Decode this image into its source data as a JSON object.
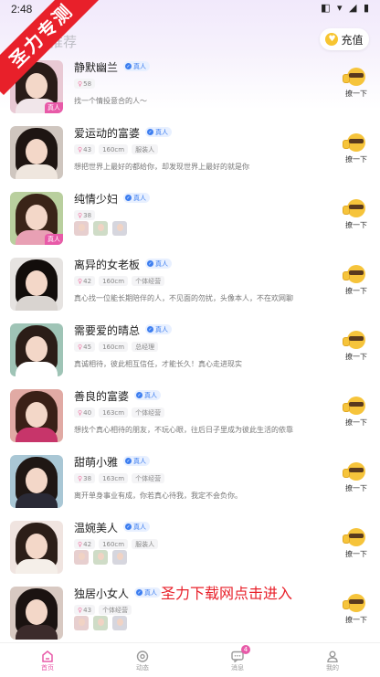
{
  "status": {
    "time": "2:48",
    "icons": "◧ ▾ ◢ ▮"
  },
  "watermark": {
    "banner": "圣力专测",
    "bottom_text": "圣力下载网点击进入"
  },
  "header": {
    "section_title": "推荐",
    "recharge_label": "充值",
    "coin_glyph": "♥"
  },
  "verify_label": "真人",
  "real_tag": "真人",
  "wave_label": "撩一下",
  "users": [
    {
      "name": "静默幽兰",
      "tags": [
        "58"
      ],
      "bio": "找一个情投意合的人～",
      "hair": "#2a1c18",
      "bg": "#e9c9d4",
      "shirt": "#f1e6ea",
      "real": true
    },
    {
      "name": "爱运动的富婆",
      "tags": [
        "43",
        "160cm",
        "服装人"
      ],
      "bio": "想把世界上最好的都给你，却发现世界上最好的就是你",
      "hair": "#1e1512",
      "bg": "#cfc6bf",
      "shirt": "#efe6de",
      "real": false
    },
    {
      "name": "纯情少妇",
      "tags": [
        "38"
      ],
      "photos": 3,
      "hair": "#3a2418",
      "bg": "#b9cf9e",
      "shirt": "#e8a0b4",
      "real": true
    },
    {
      "name": "离异的女老板",
      "tags": [
        "42",
        "160cm",
        "个体经营"
      ],
      "bio": "真心找一位能长期陪伴的人，不见面的勿扰，头像本人，不在欢网聊",
      "hair": "#120d0b",
      "bg": "#e6e3e1",
      "shirt": "#d9d4d0",
      "real": false
    },
    {
      "name": "需要爱的晴总",
      "tags": [
        "45",
        "160cm",
        "总经理"
      ],
      "bio": "真诚相待，彼此相互信任，才能长久！真心走进现实",
      "hair": "#2b1d17",
      "bg": "#9fc4b6",
      "shirt": "#ffffff",
      "real": false
    },
    {
      "name": "善良的富婆",
      "tags": [
        "40",
        "163cm",
        "个体经营"
      ],
      "bio": "想找个真心相待的朋友，不玩心眼，往后日子里成为彼此生活的依靠",
      "hair": "#3a2017",
      "bg": "#e1aaa4",
      "shirt": "#c7356a",
      "real": false
    },
    {
      "name": "甜萌小雅",
      "tags": [
        "38",
        "163cm",
        "个体经营"
      ],
      "bio": "离开单身事业有成，你若真心待我，我定不会负你。",
      "hair": "#1f1714",
      "bg": "#a9c7d5",
      "shirt": "#2a2a36",
      "real": false
    },
    {
      "name": "温婉美人",
      "tags": [
        "42",
        "160cm",
        "服装人"
      ],
      "photos": 3,
      "hair": "#2c1e18",
      "bg": "#f0e4e0",
      "shirt": "#f5efe9",
      "real": false
    },
    {
      "name": "独居小女人",
      "tags": [
        "43",
        "个体经营"
      ],
      "photos": 3,
      "hair": "#1b1311",
      "bg": "#d8c9c2",
      "shirt": "#3c2b2b",
      "real": false
    }
  ],
  "tabs": [
    {
      "label": "首页",
      "icon": "home-icon",
      "active": true
    },
    {
      "label": "动态",
      "icon": "moments-icon",
      "active": false
    },
    {
      "label": "消息",
      "icon": "message-icon",
      "active": false,
      "badge": "4"
    },
    {
      "label": "我的",
      "icon": "profile-icon",
      "active": false
    }
  ],
  "colors": {
    "accent": "#e85aa8",
    "verify": "#3d7ef0",
    "watermark": "#e8202a"
  }
}
